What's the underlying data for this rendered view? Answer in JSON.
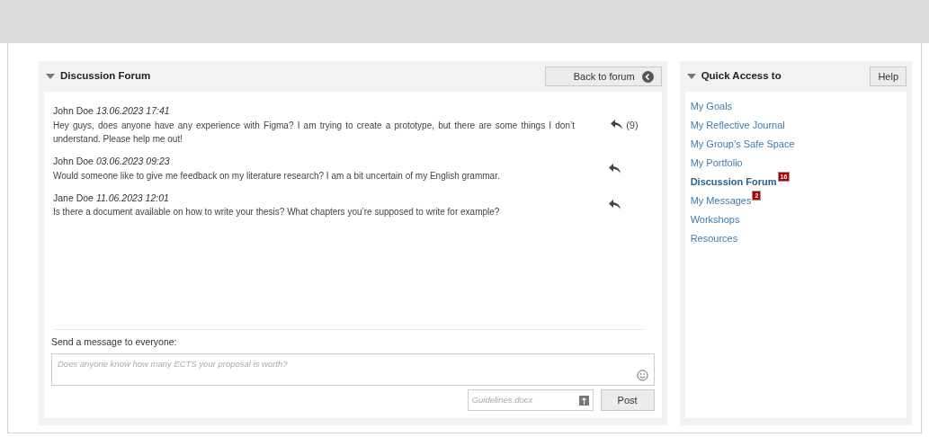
{
  "forum": {
    "title": "Discussion Forum",
    "back_button": "Back to forum",
    "posts": [
      {
        "author": "John Doe",
        "date": "13.06.2023 17:41",
        "text": "Hey guys, does anyone have any experience with Figma? I am trying to create a prototype, but there are some things I don’t understand. Please help me out!",
        "replies": "(9)"
      },
      {
        "author": "John Doe",
        "date": "03.06.2023 09:23",
        "text": "Would someone like to give me feedback on my literature research? I am a bit uncertain of my English grammar."
      },
      {
        "author": "Jane Doe",
        "date": "11.06.2023 12:01",
        "text": "Is there a document available on how to write your thesis? What chapters you’re supposed to write for example?"
      }
    ],
    "compose": {
      "label": "Send a message to everyone:",
      "placeholder": "Does anyone know how many ECTS your proposal is worth?",
      "attachment_placeholder": "Guidelines.docx",
      "post_button": "Post"
    }
  },
  "quick_access": {
    "title": "Quick Access to",
    "help_button": "Help",
    "items": [
      {
        "label": "My Goals",
        "selected": false
      },
      {
        "label": "My Reflective Journal",
        "selected": false
      },
      {
        "label": "My Group’s Safe Space",
        "selected": false
      },
      {
        "label": "My Portfolio",
        "selected": false
      },
      {
        "label": "Discussion Forum",
        "selected": true,
        "badge": "16"
      },
      {
        "label": "My Messages",
        "selected": false,
        "badge": "2"
      },
      {
        "label": "Workshops",
        "selected": false
      },
      {
        "label": "Resources",
        "selected": false
      }
    ]
  }
}
